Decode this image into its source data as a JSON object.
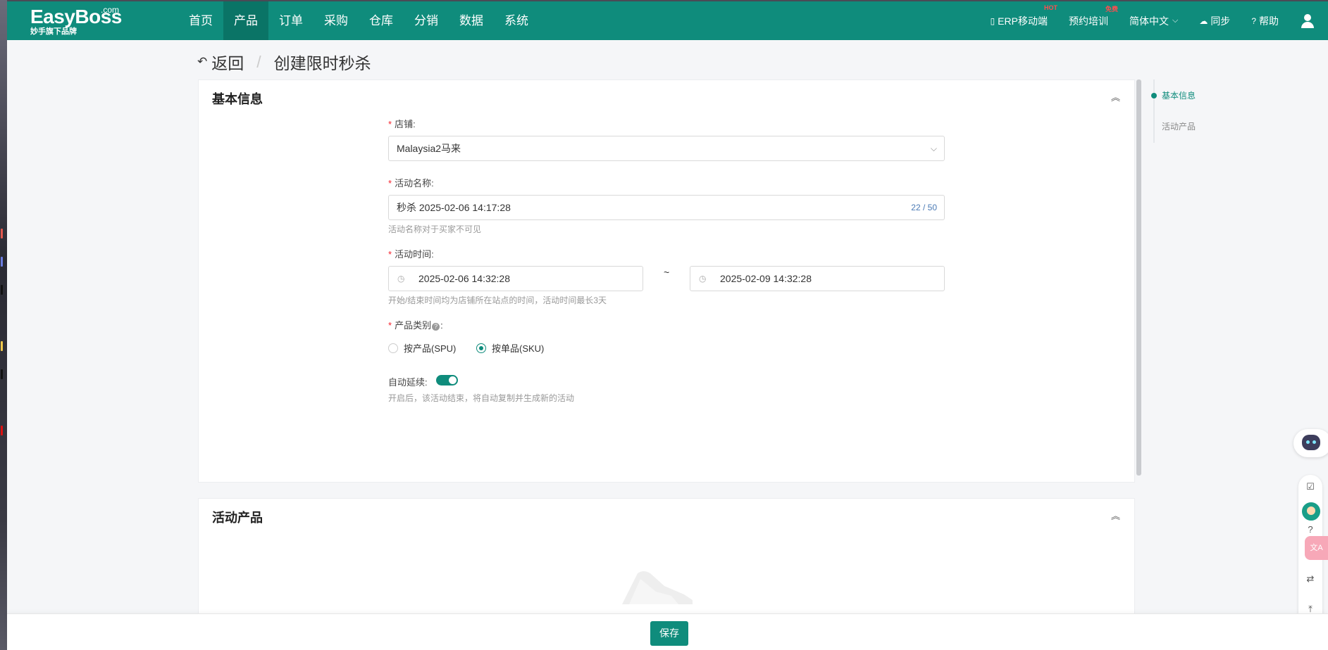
{
  "brand": {
    "name": "EasyBoss",
    "com": ".com",
    "tagline": "妙手旗下品牌"
  },
  "nav": [
    {
      "label": "首页"
    },
    {
      "label": "产品",
      "active": true
    },
    {
      "label": "订单"
    },
    {
      "label": "采购"
    },
    {
      "label": "仓库"
    },
    {
      "label": "分销"
    },
    {
      "label": "数据"
    },
    {
      "label": "系统"
    }
  ],
  "topRight": {
    "erp": "ERP移动端",
    "erp_badge": "HOT",
    "training": "预约培训",
    "training_badge": "免费",
    "language": "简体中文",
    "sync": "同步",
    "help": "帮助"
  },
  "header": {
    "back": "返回",
    "separator": "/",
    "title": "创建限时秒杀"
  },
  "basic": {
    "title": "基本信息",
    "shop_label": "店铺:",
    "shop_value": "Malaysia2马来",
    "name_label": "活动名称:",
    "name_value": "秒杀 2025-02-06 14:17:28",
    "name_counter": "22 / 50",
    "name_hint": "活动名称对于买家不可见",
    "time_label": "活动时间:",
    "start_time": "2025-02-06 14:32:28",
    "end_time": "2025-02-09 14:32:28",
    "time_separator": "~",
    "time_hint": "开始/结束时间均为店铺所在站点的时间，活动时间最长3天",
    "category_label": "产品类别",
    "category_suffix": ":",
    "option_spu": "按产品(SPU)",
    "option_sku": "按单品(SKU)",
    "selected_option": "sku",
    "auto_label": "自动延续:",
    "auto_enabled": true,
    "auto_hint": "开启后，该活动结束，将自动复制并生成新的活动"
  },
  "products": {
    "title": "活动产品"
  },
  "anchors": [
    {
      "label": "基本信息",
      "active": true
    },
    {
      "label": "活动产品",
      "active": false
    }
  ],
  "footer": {
    "save": "保存"
  },
  "colors": {
    "primary": "#0f8c7c",
    "required": "#f5222d"
  }
}
